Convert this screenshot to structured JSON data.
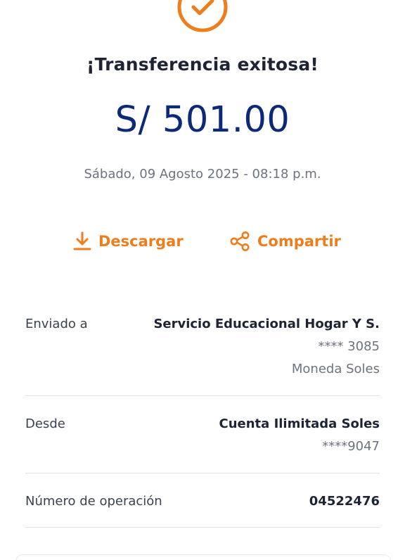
{
  "colors": {
    "accent": "#ee7d1c",
    "amount": "#0d2a78",
    "title": "#1e2433",
    "muted": "#6d7280",
    "divider": "#dfe1e6"
  },
  "header": {
    "status_icon": "check-circle-icon",
    "title": "¡Transferencia exitosa!",
    "amount": "S/ 501.00",
    "datetime": "Sábado, 09 Agosto 2025 - 08:18 p.m."
  },
  "actions": {
    "download": {
      "label": "Descargar",
      "icon": "download-icon"
    },
    "share": {
      "label": "Compartir",
      "icon": "share-icon"
    }
  },
  "details": {
    "recipient": {
      "label": "Enviado a",
      "name": "Servicio Educacional Hogar Y S.",
      "account": "**** 3085",
      "currency": "Moneda Soles"
    },
    "source": {
      "label": "Desde",
      "name": "Cuenta Ilimitada Soles",
      "account": "****9047"
    },
    "operation": {
      "label": "Número de operación",
      "value": "04522476"
    }
  }
}
